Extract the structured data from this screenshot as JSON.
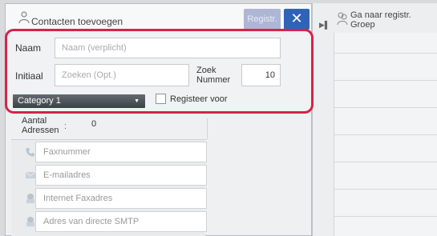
{
  "dialog": {
    "title": "Contacten toevoegen",
    "register_label": "Registr.",
    "close_label": "✕",
    "register_disabled": true
  },
  "right_panel": {
    "goto_label_line1": "Ga naar registr.",
    "goto_label_line2": "Groep"
  },
  "form": {
    "name_label": "Naam",
    "name_placeholder": "Naam (verplicht)",
    "initial_label": "Initiaal",
    "initial_placeholder": "Zoeken (Opt.)",
    "search_number_label_line1": "Zoek",
    "search_number_label_line2": "Nummer",
    "search_number_value": "10",
    "category_value": "Category 1",
    "register_for_label": "Registeer voor",
    "register_for_checked": false
  },
  "addresses": {
    "count_label_line1": "Aantal",
    "count_label_line2": "Adressen",
    "count_separator": ":",
    "count_value": "0",
    "rows": [
      {
        "icon": "fax-icon",
        "placeholder": "Faxnummer"
      },
      {
        "icon": "email-icon",
        "placeholder": "E-mailadres"
      },
      {
        "icon": "internet-fax-icon",
        "placeholder": "Internet Faxadres"
      },
      {
        "icon": "smtp-icon",
        "placeholder": "Adres van directe SMTP"
      }
    ]
  },
  "colors": {
    "highlight": "#d6234a",
    "close_button": "#2f63b7",
    "register_button_disabled": "#aeb6d6"
  }
}
